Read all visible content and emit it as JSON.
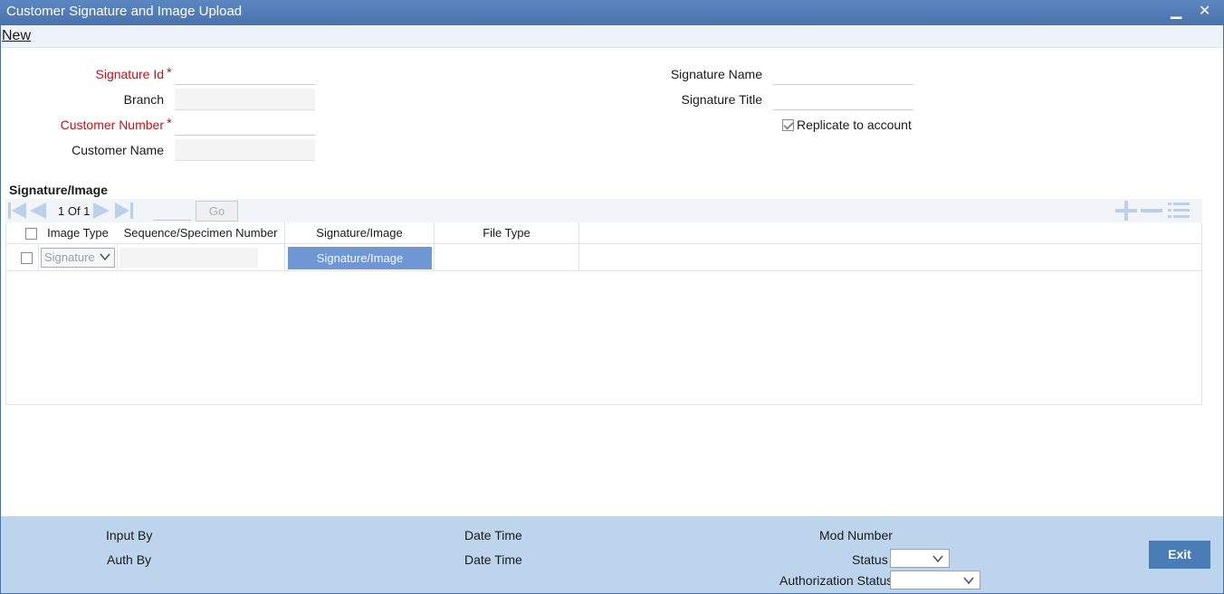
{
  "window": {
    "title": "Customer Signature and Image Upload",
    "minimize": "▁",
    "close": "✕"
  },
  "menu": {
    "new": "New"
  },
  "form": {
    "signature_id_label": "Signature Id",
    "branch_label": "Branch",
    "customer_number_label": "Customer Number",
    "customer_name_label": "Customer Name",
    "signature_name_label": "Signature Name",
    "signature_title_label": "Signature Title",
    "replicate_label": "Replicate to account",
    "replicate_checked": true,
    "required_mark": "*"
  },
  "section": {
    "title": "Signature/Image"
  },
  "pager": {
    "text": "1 Of 1",
    "go": "Go"
  },
  "grid": {
    "headers": [
      "Image Type",
      "Sequence/Specimen Number",
      "Signature/Image",
      "File Type"
    ],
    "rows": [
      {
        "image_type": "Signature",
        "sequence": "",
        "button": "Signature/Image",
        "file_type": ""
      }
    ]
  },
  "footer": {
    "input_by": "Input By",
    "auth_by": "Auth By",
    "date_time_1": "Date Time",
    "date_time_2": "Date Time",
    "mod_number": "Mod Number",
    "status": "Status",
    "authorization_status": "Authorization Status",
    "exit": "Exit"
  },
  "colors": {
    "titlebar": "#4a73ad",
    "footer": "#bcd5ec",
    "required": "#c0141b",
    "button": "#6f97d4",
    "exit": "#4a7db6"
  }
}
